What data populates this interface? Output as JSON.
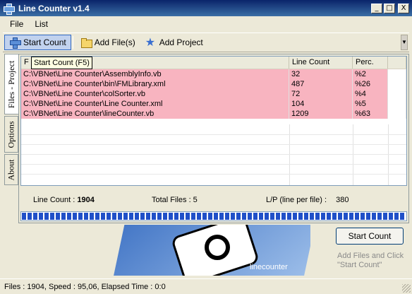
{
  "window": {
    "title": "Line Counter v1.4",
    "minimize": "_",
    "maximize": "□",
    "close": "X"
  },
  "menu": [
    {
      "label": "File"
    },
    {
      "label": "List"
    }
  ],
  "toolbar": {
    "start_count": "Start Count",
    "add_files": "Add File(s)",
    "add_project": "Add Project"
  },
  "tooltip": "Start Count (F5)",
  "tabs": [
    "Files - Project",
    "Options",
    "About"
  ],
  "list": {
    "headers": [
      "F",
      "Line Count",
      "Perc.",
      ""
    ],
    "rows": [
      {
        "file": "C:\\VBNet\\Line Counter\\AssemblyInfo.vb",
        "lines": "32",
        "perc": "%2"
      },
      {
        "file": "C:\\VBNet\\Line Counter\\bin\\FMLibrary.xml",
        "lines": "487",
        "perc": "%26"
      },
      {
        "file": "C:\\VBNet\\Line Counter\\colSorter.vb",
        "lines": "72",
        "perc": "%4"
      },
      {
        "file": "C:\\VBNet\\Line Counter\\Line Counter.xml",
        "lines": "104",
        "perc": "%5"
      },
      {
        "file": "C:\\VBNet\\Line Counter\\lineCounter.vb",
        "lines": "1209",
        "perc": "%63"
      }
    ]
  },
  "stats": {
    "line_count_label": "Line Count :",
    "line_count_value": "1904",
    "total_files": "Total Files : 5",
    "lp": "L/P (line per file) :",
    "lp_value": "380"
  },
  "progress": 1.0,
  "logo_text": "linecounter",
  "start_button": "Start Count",
  "hint": "Add Files and Click \"Start Count\"",
  "status": "Files : 1904, Speed : 95,06, Elapsed Time : 0:0",
  "colors": {
    "titlebar": "#0a246a",
    "row_highlight": "#f8b4c0",
    "progress": "#2050c8"
  }
}
